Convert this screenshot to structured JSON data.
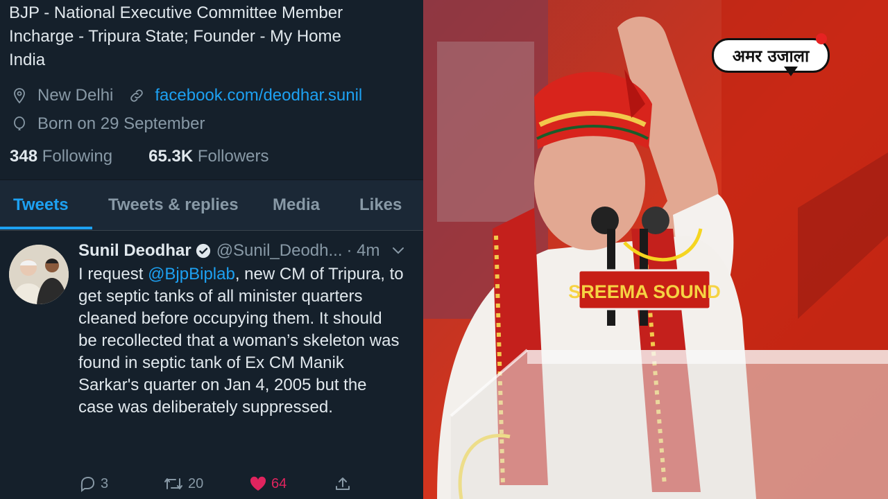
{
  "profile": {
    "bio_line1": "BJP - National Executive Committee Member",
    "bio_line2": "Incharge - Tripura State; Founder - My Home",
    "bio_line3": "India",
    "location": "New Delhi",
    "website": "facebook.com/deodhar.sunil",
    "birthday": "Born on 29 September",
    "following_count": "348",
    "following_label": "Following",
    "followers_count": "65.3K",
    "followers_label": "Followers"
  },
  "tabs": [
    {
      "label": "Tweets"
    },
    {
      "label": "Tweets & replies"
    },
    {
      "label": "Media"
    },
    {
      "label": "Likes"
    }
  ],
  "tweet": {
    "name": "Sunil Deodhar",
    "handle": "@Sunil_Deodh...",
    "time": "· 4m",
    "text_before": "I request ",
    "mention": "@BjpBiplab",
    "text_after": ", new CM of Tripura, to get septic tanks of all minister quarters cleaned before occupying them. It should be recollected that a woman’s skeleton was found in septic tank of Ex CM Manik Sarkar's quarter on Jan 4, 2005 but the case was deliberately suppressed.",
    "replies": "3",
    "retweets": "20",
    "likes": "64"
  },
  "photo": {
    "logo_text": "अमर उजाला",
    "podium_sign": "SREEMA SOUND"
  },
  "colors": {
    "background": "#15202b",
    "accent": "#1da1f2",
    "like": "#e0245e"
  }
}
